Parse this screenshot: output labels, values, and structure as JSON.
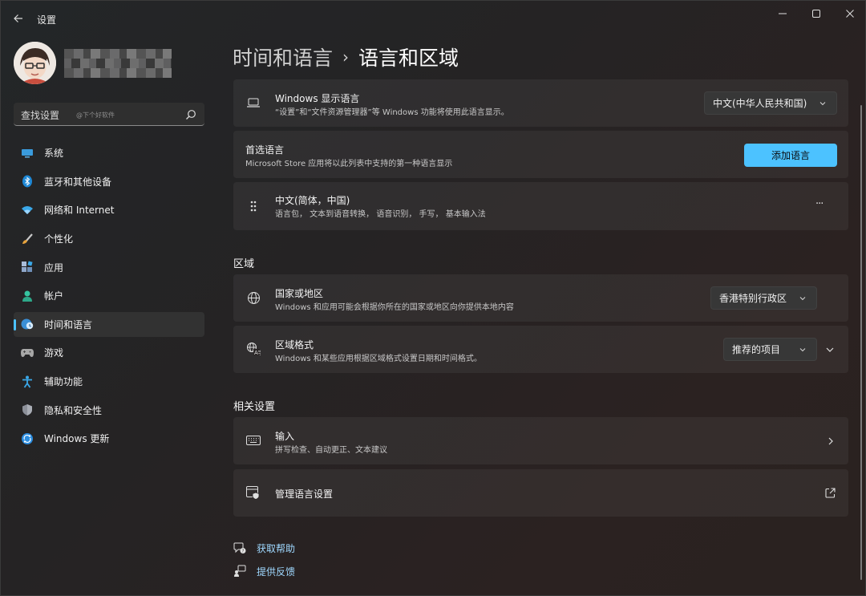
{
  "app": {
    "title": "设置"
  },
  "search": {
    "label": "查找设置",
    "hint": "@下个好软件"
  },
  "nav": {
    "items": [
      {
        "label": "系统",
        "icon": "display-icon"
      },
      {
        "label": "蓝牙和其他设备",
        "icon": "bluetooth-icon"
      },
      {
        "label": "网络和 Internet",
        "icon": "wifi-icon"
      },
      {
        "label": "个性化",
        "icon": "brush-icon"
      },
      {
        "label": "应用",
        "icon": "apps-icon"
      },
      {
        "label": "帐户",
        "icon": "account-icon"
      },
      {
        "label": "时间和语言",
        "icon": "globe-clock-icon",
        "active": true
      },
      {
        "label": "游戏",
        "icon": "gamepad-icon"
      },
      {
        "label": "辅助功能",
        "icon": "accessibility-icon"
      },
      {
        "label": "隐私和安全性",
        "icon": "shield-icon"
      },
      {
        "label": "Windows 更新",
        "icon": "update-icon"
      }
    ]
  },
  "breadcrumb": {
    "parent": "时间和语言",
    "separator": "›",
    "current": "语言和区域"
  },
  "display_language": {
    "title": "Windows 显示语言",
    "desc": "“设置”和“文件资源管理器”等 Windows 功能将使用此语言显示。",
    "value": "中文(中华人民共和国)"
  },
  "preferred_language": {
    "title": "首选语言",
    "desc": "Microsoft Store 应用将以此列表中支持的第一种语言显示",
    "button": "添加语言"
  },
  "language_item": {
    "title": "中文(简体，中国)",
    "desc": "语言包， 文本到语音转换， 语音识别， 手写， 基本输入法",
    "more": "···"
  },
  "region": {
    "section": "区域",
    "country": {
      "title": "国家或地区",
      "desc": "Windows 和应用可能会根据你所在的国家或地区向你提供本地内容",
      "value": "香港特别行政区"
    },
    "format": {
      "title": "区域格式",
      "desc": "Windows 和某些应用根据区域格式设置日期和时间格式。",
      "value": "推荐的项目"
    }
  },
  "related": {
    "section": "相关设置",
    "input": {
      "title": "输入",
      "desc": "拼写检查、自动更正、文本建议"
    },
    "admin": {
      "title": "管理语言设置"
    }
  },
  "links": {
    "help": "获取帮助",
    "feedback": "提供反馈"
  },
  "colors": {
    "accent": "#4cc2ff",
    "link": "#9fd8ff"
  }
}
